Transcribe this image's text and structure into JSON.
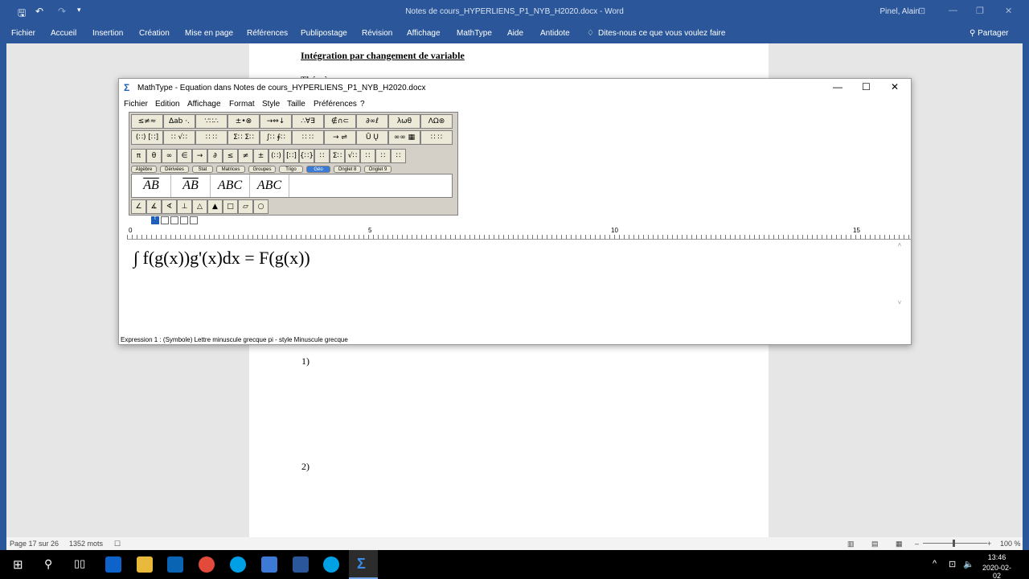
{
  "word": {
    "title": "Notes de cours_HYPERLIENS_P1_NYB_H2020.docx - Word",
    "user": "Pinel, Alain",
    "tabs": [
      "Fichier",
      "Accueil",
      "Insertion",
      "Création",
      "Mise en page",
      "Références",
      "Publipostage",
      "Révision",
      "Affichage",
      "MathType",
      "Aide",
      "Antidote"
    ],
    "tell_me": "Dites-nous ce que vous voulez faire",
    "share": "Partager"
  },
  "document": {
    "heading": "Intégration par changement de variable",
    "hidden_line": "Théorème",
    "item1": "1)",
    "item2": "2)"
  },
  "status": {
    "page": "Page 17 sur 26",
    "words": "1352 mots",
    "zoom": "100 %"
  },
  "mathtype": {
    "title": "MathType - Equation dans Notes de cours_HYPERLIENS_P1_NYB_H2020.docx",
    "menu": [
      "Fichier",
      "Edition",
      "Affichage",
      "Format",
      "Style",
      "Taille",
      "Préférences",
      "?"
    ],
    "palette_row1": [
      "≤≠≈",
      "∆ab ·.",
      "∵∷∴",
      "±•⊗",
      "→⇔↓",
      "∴∀∃",
      "∉∩⊂",
      "∂∞ℓ",
      "λωθ",
      "ΛΩ⊛"
    ],
    "palette_row2": [
      "(∷) [∷]",
      "∷ √∷",
      "∷ ∷",
      "Σ∷ Σ∷",
      "∫∷ ∮∷",
      "∷ ∷",
      "→ ⇌",
      "Ū Ų",
      "∞∞ ▦",
      "∷ ∷"
    ],
    "palette_row3": [
      "π",
      "θ",
      "∞",
      "∈",
      "→",
      "∂",
      "≤",
      "≠",
      "±",
      "(∷)",
      "[∷]",
      "{∷}",
      "∷",
      "Σ∷",
      "√∷",
      "∷",
      "∷",
      "∷"
    ],
    "palette_tabs": [
      "Algèbre",
      "Dérivées",
      "Stat",
      "Matrices",
      "Groupes",
      "Trigo",
      "Géo",
      "Onglet 8",
      "Onglet 9"
    ],
    "selected_tab": "Géo",
    "templates": [
      "AB",
      "AB",
      "ABC",
      "ABC"
    ],
    "geo_row": [
      "∠",
      "∡",
      "∢",
      "⊥",
      "△",
      "▲",
      "□",
      "▱",
      "○"
    ],
    "ruler_marks": [
      "0",
      "5",
      "10",
      "15"
    ],
    "equation": "∫ f(g(x))g'(x)dx = F(g(x))",
    "status": "Expression 1 : (Symbole) Lettre minuscule grecque pi - style Minuscule grecque"
  },
  "clock": {
    "time": "13:46",
    "date": "2020-02-02"
  }
}
